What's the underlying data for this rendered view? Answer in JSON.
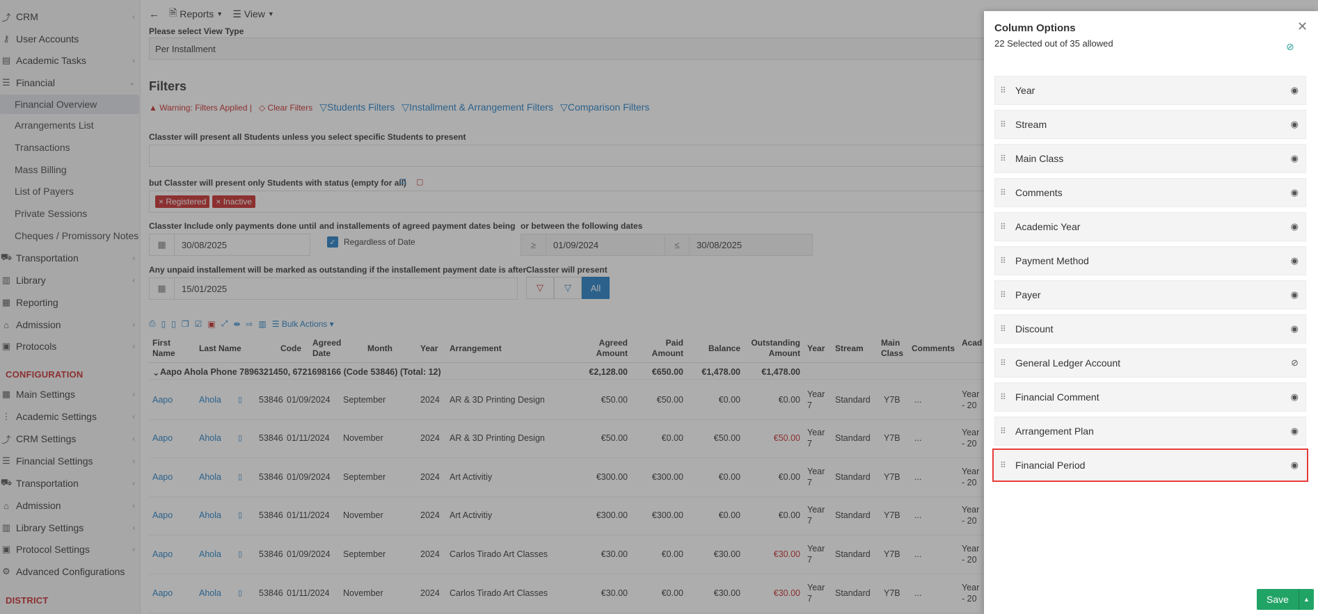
{
  "sidebar": {
    "items": [
      {
        "label": "CRM",
        "icon": "crm-icon",
        "chevron": true
      },
      {
        "label": "User Accounts",
        "icon": "key-icon",
        "chevron": false
      },
      {
        "label": "Academic Tasks",
        "icon": "tasks-icon",
        "chevron": true
      },
      {
        "label": "Financial",
        "icon": "financial-icon",
        "chevron": true
      }
    ],
    "financial_sub": [
      {
        "label": "Financial Overview",
        "active": true
      },
      {
        "label": "Arrangements List"
      },
      {
        "label": "Transactions"
      },
      {
        "label": "Mass Billing"
      },
      {
        "label": "List of Payers"
      },
      {
        "label": "Private Sessions"
      },
      {
        "label": "Cheques / Promissory Notes"
      }
    ],
    "items2": [
      {
        "label": "Transportation",
        "icon": "bus-icon",
        "chevron": true
      },
      {
        "label": "Library",
        "icon": "library-icon",
        "chevron": true
      },
      {
        "label": "Reporting",
        "icon": "reporting-icon",
        "chevron": false
      },
      {
        "label": "Admission",
        "icon": "admission-icon",
        "chevron": true
      },
      {
        "label": "Protocols",
        "icon": "protocols-icon",
        "chevron": true
      }
    ],
    "config_header": "CONFIGURATION",
    "config_items": [
      {
        "label": "Main Settings",
        "icon": "settings-icon"
      },
      {
        "label": "Academic Settings",
        "icon": "academic-settings-icon"
      },
      {
        "label": "CRM Settings",
        "icon": "crm-icon"
      },
      {
        "label": "Financial Settings",
        "icon": "financial-icon"
      },
      {
        "label": "Transportation",
        "icon": "bus-icon"
      },
      {
        "label": "Admission",
        "icon": "admission-icon"
      },
      {
        "label": "Library Settings",
        "icon": "library-icon"
      },
      {
        "label": "Protocol Settings",
        "icon": "protocols-icon"
      },
      {
        "label": "Advanced Configurations",
        "icon": "gear-icon"
      }
    ],
    "district_header": "DISTRICT"
  },
  "toolbar": {
    "reports": "Reports",
    "view": "View"
  },
  "view_type": {
    "label": "Please select View Type",
    "value": "Per Installment"
  },
  "filters": {
    "heading": "Filters",
    "warning": "Warning: Filters Applied",
    "clear": "Clear Filters",
    "students": "Students Filters",
    "installment": "Installment & Arrangement Filters",
    "comparison": "Comparison Filters",
    "students_note": "Classter will present all Students unless you select specific Students to present",
    "status_note": "but Classter will present only Students with status (empty for all)",
    "status_tags": [
      "Registered",
      "Inactive"
    ],
    "payments_until_label": "Classter Include only payments done until",
    "payments_until": "30/08/2025",
    "agreed_label": "and installements of agreed payment dates being",
    "regardless": "Regardless of Date",
    "between_label": "or between the following dates",
    "from_op": "≥",
    "from_date": "01/09/2024",
    "to_op": "≤",
    "to_date": "30/08/2025",
    "unpaid_label": "Any unpaid installement will be marked as outstanding if the installement payment date is after",
    "unpaid_date": "15/01/2025",
    "present_label": "Classter will present",
    "present_all": "All"
  },
  "table": {
    "bulk": "Bulk Actions",
    "headers": [
      "First Name",
      "Last Name",
      "Code",
      "Agreed Date",
      "Month",
      "Year",
      "Arrangement",
      "Agreed Amount",
      "Paid Amount",
      "Balance",
      "Outstanding Amount",
      "Year",
      "Stream",
      "Main Class",
      "Comments",
      "Academic Year"
    ],
    "group": {
      "label": "Aapo Ahola Phone 7896321450, 6721698166 (Code 53846) (Total: 12)",
      "agreed": "€2,128.00",
      "paid": "€650.00",
      "balance": "€1,478.00",
      "outstanding": "€1,478.00"
    },
    "rows": [
      {
        "first": "Aapo",
        "last": "Ahola",
        "code": "53846",
        "date": "01/09/2024",
        "month": "September",
        "year": "2024",
        "arr": "AR & 3D Printing Design",
        "agreed": "€50.00",
        "paid": "€50.00",
        "balance": "€0.00",
        "out": "€0.00",
        "out_red": false,
        "yr": "Year 7",
        "stream": "Standard",
        "cls": "Y7B",
        "comments": "...",
        "acad": "Year - 20"
      },
      {
        "first": "Aapo",
        "last": "Ahola",
        "code": "53846",
        "date": "01/11/2024",
        "month": "November",
        "year": "2024",
        "arr": "AR & 3D Printing Design",
        "agreed": "€50.00",
        "paid": "€0.00",
        "balance": "€50.00",
        "out": "€50.00",
        "out_red": true,
        "yr": "Year 7",
        "stream": "Standard",
        "cls": "Y7B",
        "comments": "...",
        "acad": "Year - 20"
      },
      {
        "first": "Aapo",
        "last": "Ahola",
        "code": "53846",
        "date": "01/09/2024",
        "month": "September",
        "year": "2024",
        "arr": "Art Activitiy",
        "agreed": "€300.00",
        "paid": "€300.00",
        "balance": "€0.00",
        "out": "€0.00",
        "out_red": false,
        "yr": "Year 7",
        "stream": "Standard",
        "cls": "Y7B",
        "comments": "...",
        "acad": "Year - 20"
      },
      {
        "first": "Aapo",
        "last": "Ahola",
        "code": "53846",
        "date": "01/11/2024",
        "month": "November",
        "year": "2024",
        "arr": "Art Activitiy",
        "agreed": "€300.00",
        "paid": "€300.00",
        "balance": "€0.00",
        "out": "€0.00",
        "out_red": false,
        "yr": "Year 7",
        "stream": "Standard",
        "cls": "Y7B",
        "comments": "...",
        "acad": "Year - 20"
      },
      {
        "first": "Aapo",
        "last": "Ahola",
        "code": "53846",
        "date": "01/09/2024",
        "month": "September",
        "year": "2024",
        "arr": "Carlos Tirado Art Classes",
        "agreed": "€30.00",
        "paid": "€0.00",
        "balance": "€30.00",
        "out": "€30.00",
        "out_red": true,
        "yr": "Year 7",
        "stream": "Standard",
        "cls": "Y7B",
        "comments": "...",
        "acad": "Year - 20"
      },
      {
        "first": "Aapo",
        "last": "Ahola",
        "code": "53846",
        "date": "01/11/2024",
        "month": "November",
        "year": "2024",
        "arr": "Carlos Tirado Art Classes",
        "agreed": "€30.00",
        "paid": "€0.00",
        "balance": "€30.00",
        "out": "€30.00",
        "out_red": true,
        "yr": "Year 7",
        "stream": "Standard",
        "cls": "Y7B",
        "comments": "...",
        "acad": "Year - 20"
      }
    ]
  },
  "panel": {
    "title": "Column Options",
    "subtitle": "22 Selected out of 35 allowed",
    "options": [
      {
        "label": "Year",
        "visible": true
      },
      {
        "label": "Stream",
        "visible": true
      },
      {
        "label": "Main Class",
        "visible": true
      },
      {
        "label": "Comments",
        "visible": true
      },
      {
        "label": "Academic Year",
        "visible": true
      },
      {
        "label": "Payment Method",
        "visible": true
      },
      {
        "label": "Payer",
        "visible": true
      },
      {
        "label": "Discount",
        "visible": true
      },
      {
        "label": "General Ledger Account",
        "visible": false
      },
      {
        "label": "Financial Comment",
        "visible": true
      },
      {
        "label": "Arrangement Plan",
        "visible": true
      },
      {
        "label": "Financial Period",
        "visible": true,
        "highlighted": true
      }
    ],
    "save": "Save"
  },
  "colors": {
    "accent": "#1f7dc4",
    "danger": "#c62828",
    "save": "#21a366",
    "highlight": "#e53935"
  }
}
